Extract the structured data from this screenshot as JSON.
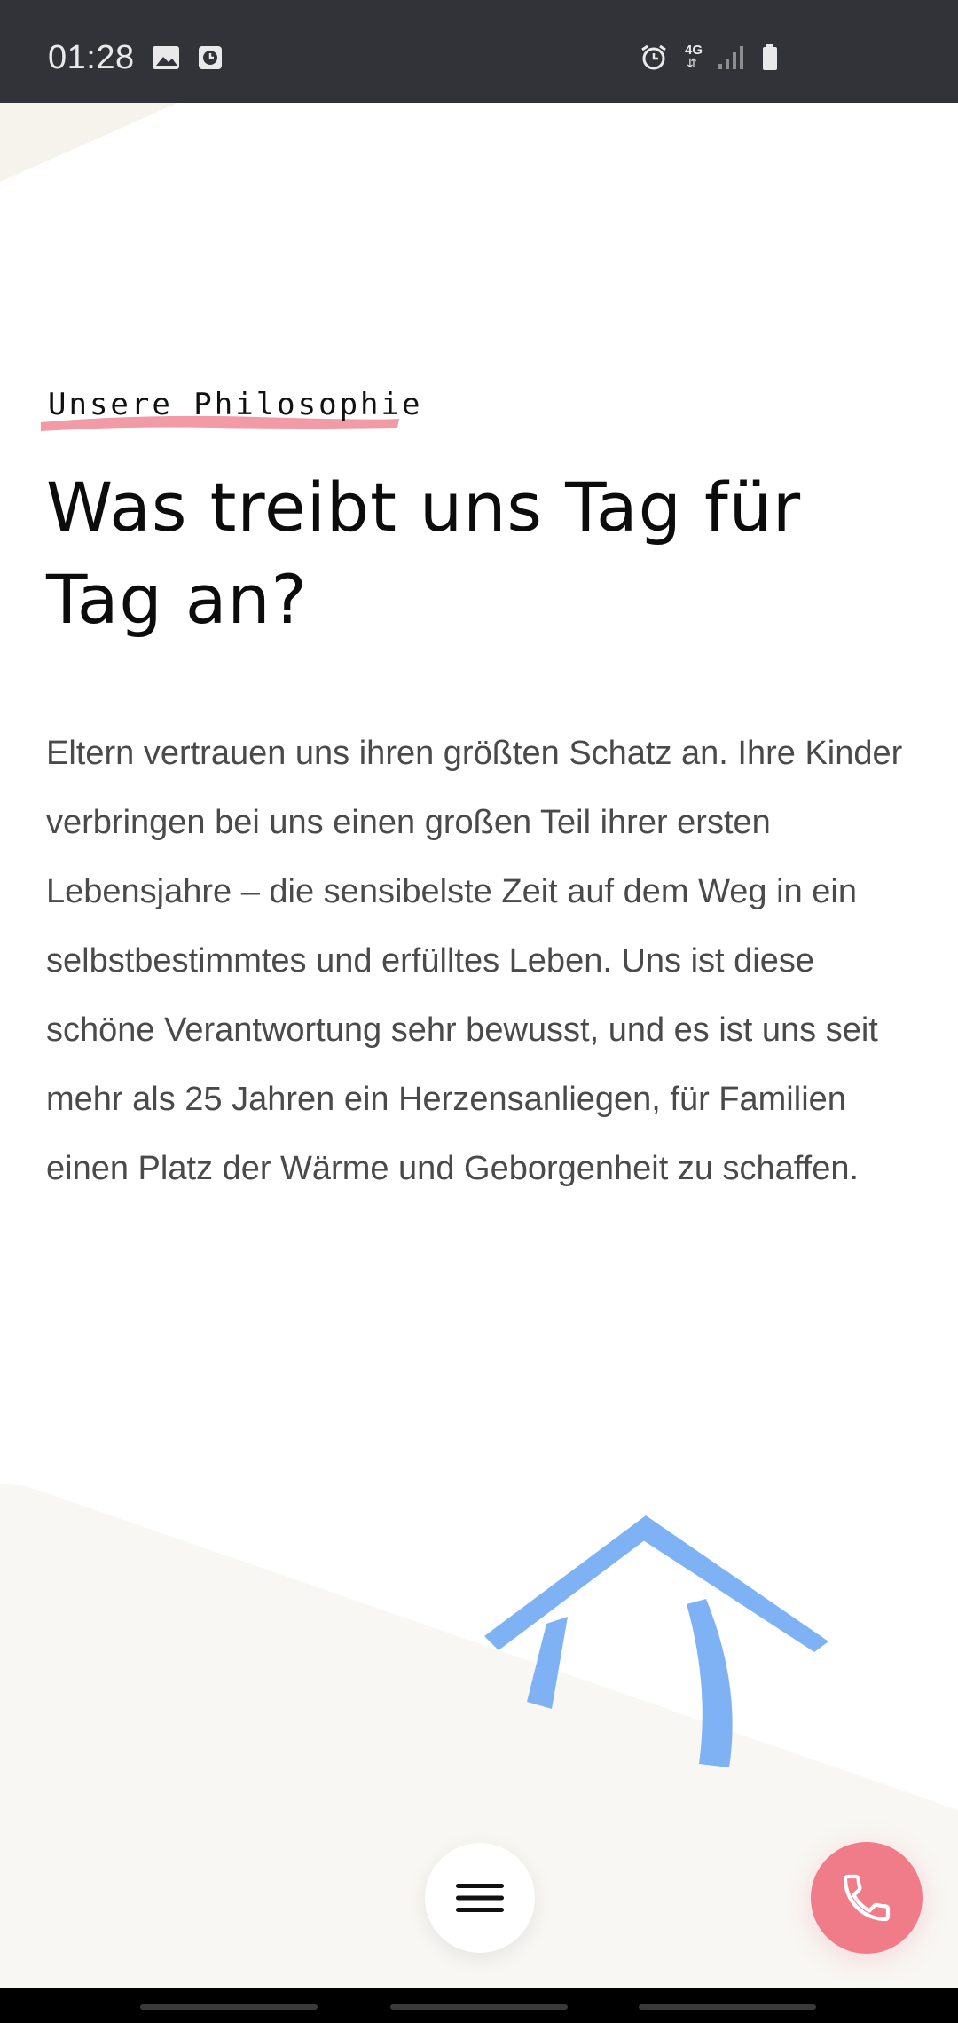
{
  "status_bar": {
    "time": "01:28",
    "icons": [
      "image-icon",
      "clock-app-icon",
      "alarm-icon",
      "4g-icon",
      "signal-icon",
      "battery-icon"
    ],
    "network_label": "4G"
  },
  "section": {
    "eyebrow": "Unsere Philosophie",
    "headline": "Was treibt uns Tag für Tag an?",
    "body": "Eltern vertrauen uns ihren größten Schatz an. Ihre Kinder verbringen bei uns einen großen Teil ihrer ersten Lebensjahre – die sensibelste Zeit auf dem Weg in ein selbstbestimmtes und erfülltes Leben. Uns ist diese schöne Verantwortung sehr bewusst, und es ist uns seit mehr als 25 Jahren ein Herzensanliegen, für Familien einen Platz der Wärme und Geborgenheit zu schaffen."
  },
  "buttons": {
    "menu": "hamburger-menu-icon",
    "call": "phone-icon"
  },
  "colors": {
    "accent_pink": "#f07c89",
    "accent_blue": "#7fb2f5",
    "beige": "#f7f5f0",
    "status_bar": "#323338"
  }
}
